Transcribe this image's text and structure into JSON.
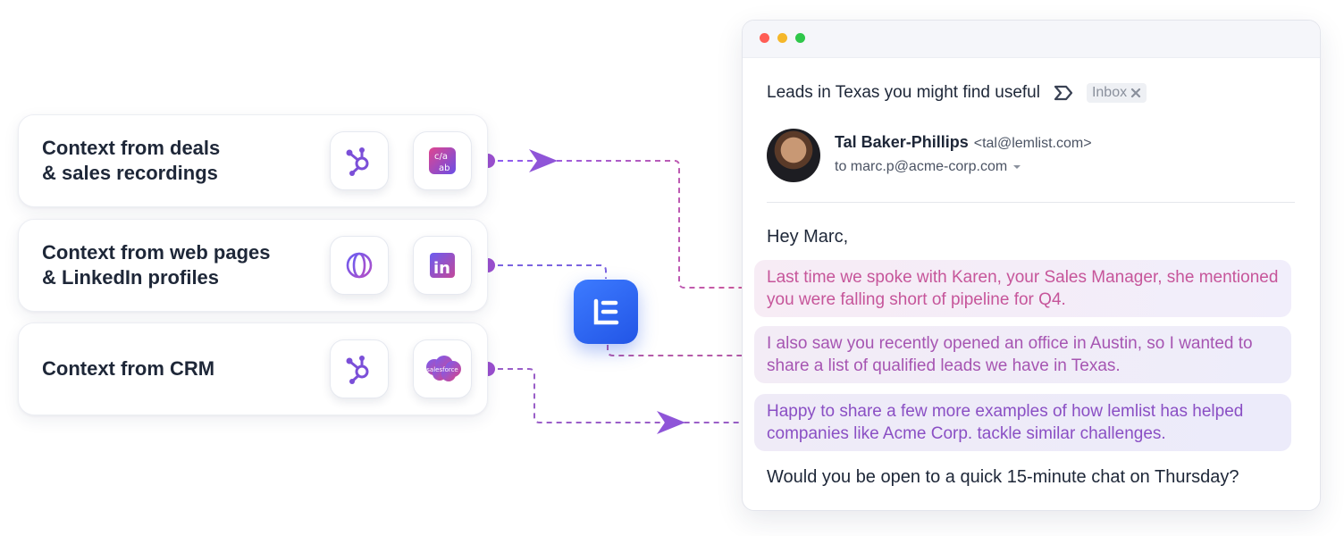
{
  "context_cards": [
    {
      "label": "Context from deals\n& sales recordings",
      "icons": [
        "hubspot-icon",
        "translate-icon"
      ]
    },
    {
      "label": "Context from web pages\n& LinkedIn profiles",
      "icons": [
        "globe-icon",
        "linkedin-icon"
      ]
    },
    {
      "label": "Context from CRM",
      "icons": [
        "hubspot-icon",
        "salesforce-icon"
      ]
    }
  ],
  "salesforce_text": "salesforce",
  "linkedin_text": "in",
  "email": {
    "subject": "Leads in Texas you might find useful",
    "tag": "Inbox",
    "sender_name": "Tal Baker-Phillips",
    "sender_email": "<tal@lemlist.com>",
    "recipient": "to marc.p@acme-corp.com",
    "greeting": "Hey Marc,",
    "highlights": [
      "Last time we spoke with Karen, your Sales Manager, she mentioned you were falling short of pipeline for Q4.",
      "I also saw you recently opened an office in Austin, so I wanted to share a list of qualified leads we have in Texas.",
      "Happy to share a few more examples of how lemlist has helped companies like Acme Corp. tackle similar challenges."
    ],
    "closing": "Would you be open to a quick 15-minute chat on Thursday?"
  },
  "colors": {
    "accent_blue": "#2f6bf2",
    "connector_purple": "#8b5cf6",
    "connector_pink": "#c25aa0",
    "highlight_1_text": "#c6559a",
    "highlight_2_text": "#a655b2",
    "highlight_3_text": "#8a4fc4"
  }
}
